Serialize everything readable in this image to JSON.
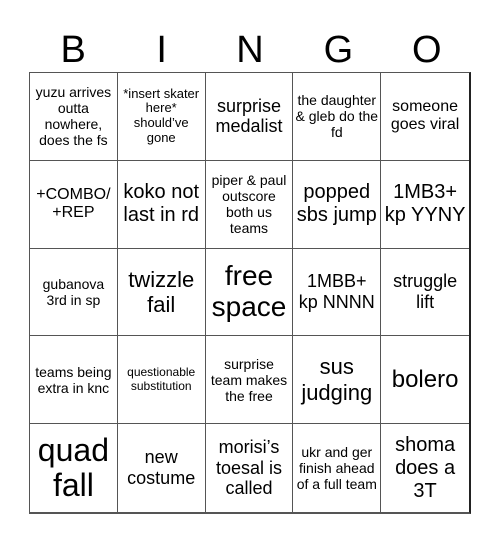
{
  "header": [
    "B",
    "I",
    "N",
    "G",
    "O"
  ],
  "cells": [
    "yuzu arrives outta nowhere, does the fs",
    "*insert skater here* should’ve gone",
    "surprise medalist",
    "the daughter & gleb do the fd",
    "someone goes viral",
    "+COMBO/ +REP",
    "koko not last in rd",
    "piper & paul outscore both us teams",
    "popped sbs jump",
    "1MB3+ kp YYNY",
    "gubanova 3rd in sp",
    "twizzle fail",
    "free space",
    "1MBB+ kp NNNN",
    "struggle lift",
    "teams being extra in knc",
    "questionable substitution",
    "surprise team makes the free",
    "sus judging",
    "bolero",
    "quad fall",
    "new costume",
    "morisi’s toesal is called",
    "ukr and ger finish ahead of a full team",
    "shoma does a 3T"
  ]
}
